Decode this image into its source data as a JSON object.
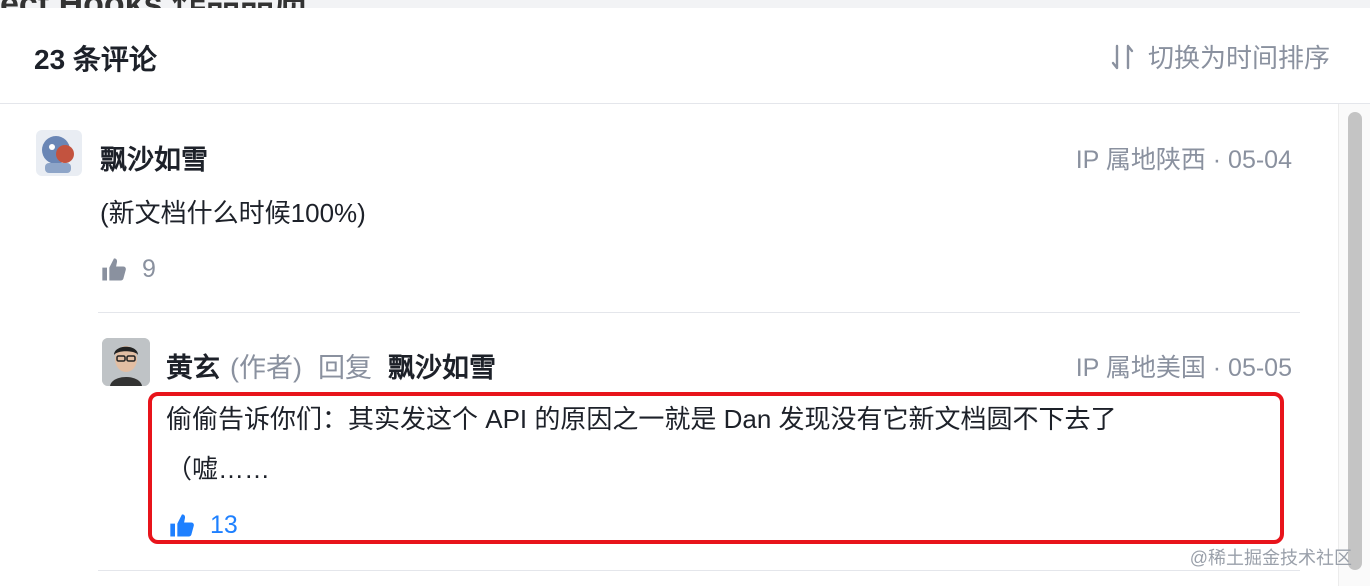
{
  "header": {
    "title": "23 条评论",
    "sort_label": "切换为时间排序"
  },
  "comment": {
    "author": "飘沙如雪",
    "meta": "IP 属地陕西 · 05-04",
    "text": "(新文档什么时候100%)",
    "likes": "9"
  },
  "reply": {
    "author": "黄玄",
    "author_tag": "(作者)",
    "verb": "回复",
    "target": "飘沙如雪",
    "meta": "IP 属地美国 · 05-05",
    "text_line1": "偷偷告诉你们：其实发这个 API 的原因之一就是 Dan 发现没有它新文档圆不下去了",
    "text_line2": "（嘘……",
    "likes": "13"
  },
  "watermark": "@稀土掘金技术社区",
  "colors": {
    "accent": "#1e80ff",
    "muted": "#8a919f",
    "highlight": "#e8141b"
  }
}
